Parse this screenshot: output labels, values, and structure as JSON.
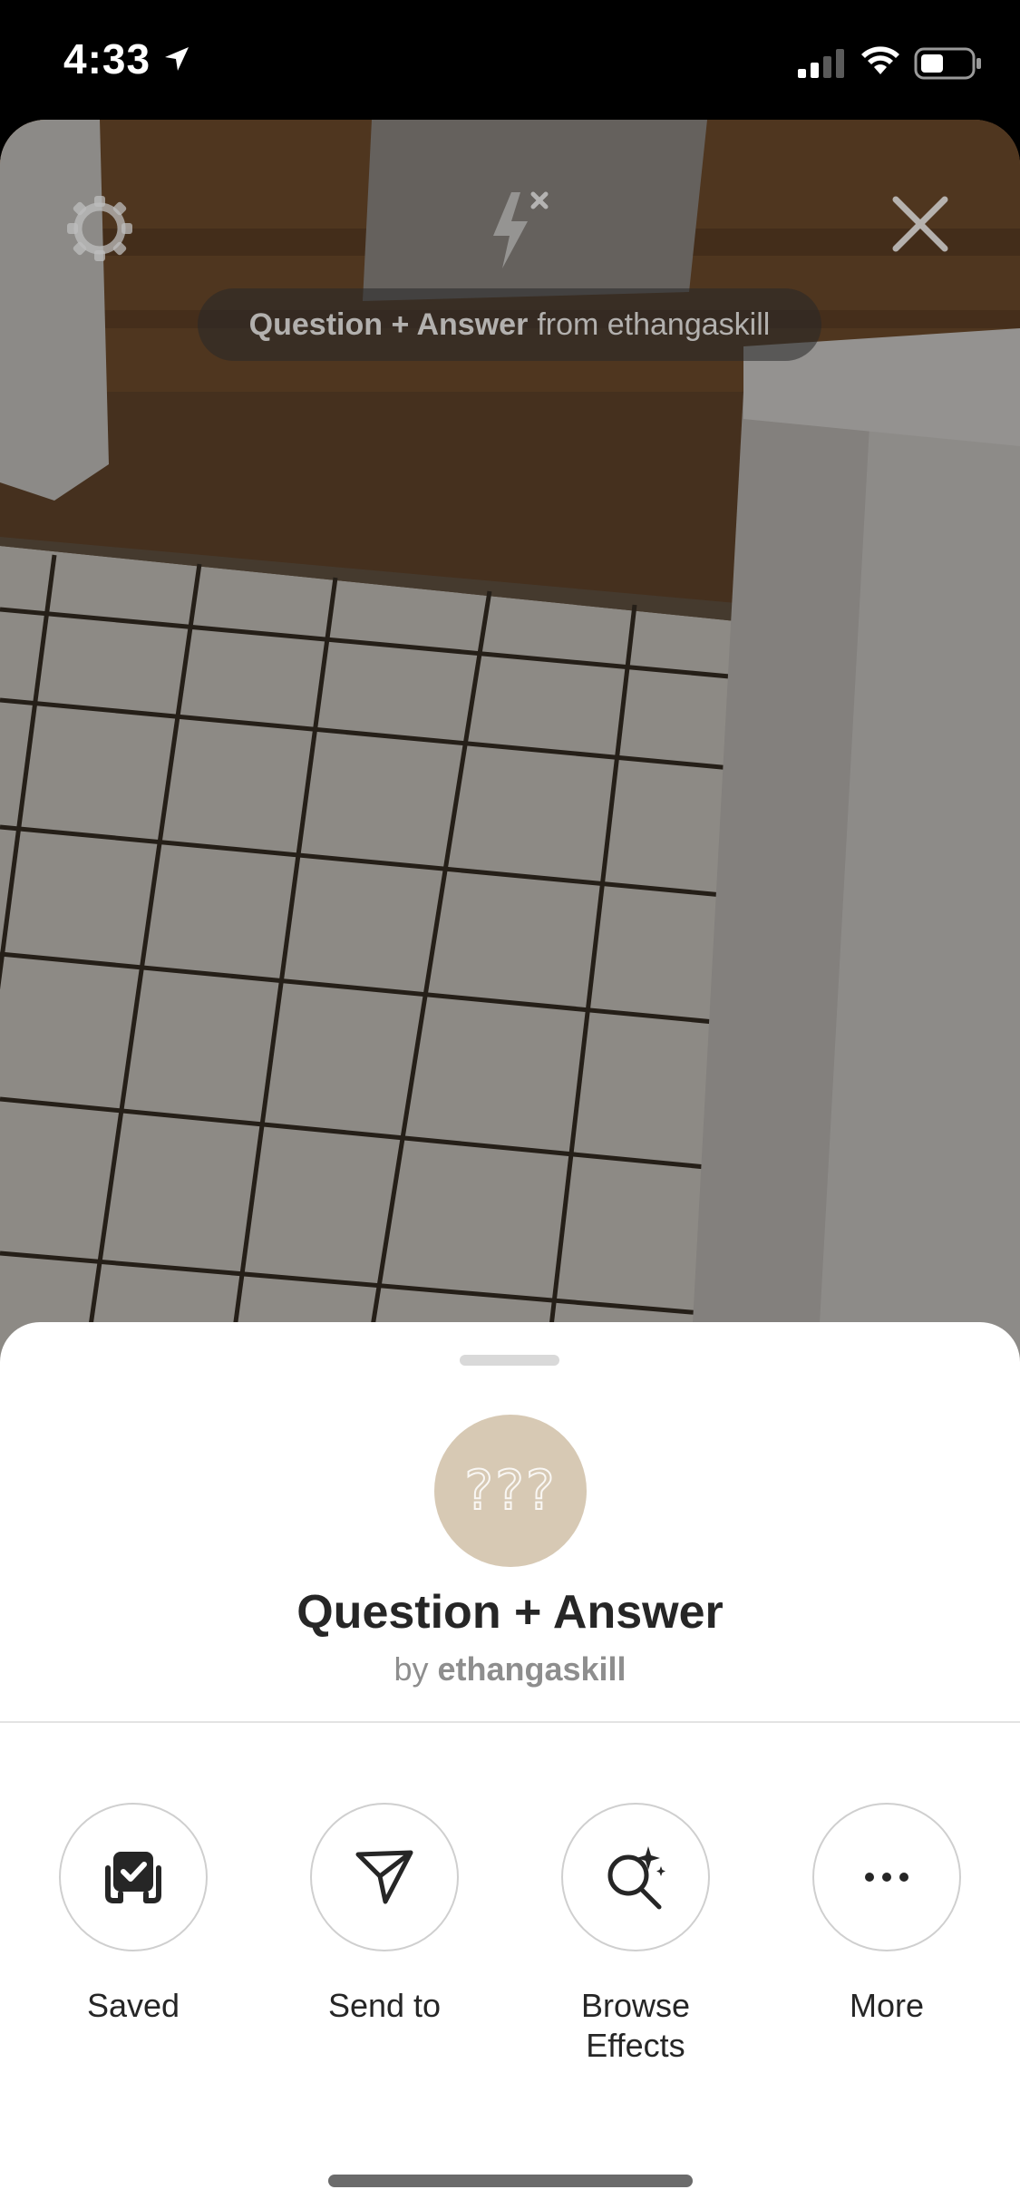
{
  "status_bar": {
    "time": "4:33",
    "icons": [
      "location-arrow-icon",
      "signal-icon",
      "wifi-icon",
      "battery-icon"
    ]
  },
  "camera": {
    "controls": [
      "settings-icon",
      "flash-off-icon",
      "close-icon"
    ],
    "effect_pill": {
      "title": "Question + Answer",
      "from_text": "from ethangaskill"
    }
  },
  "sheet": {
    "thumbnail_text": "???",
    "thumbnail_color": "#d7c9b4",
    "title": "Question + Answer",
    "by_prefix": "by",
    "author": "ethangaskill",
    "actions": [
      {
        "label": "Saved",
        "icon": "saved-check-icon"
      },
      {
        "label": "Send to",
        "icon": "send-icon"
      },
      {
        "label": "Browse\nEffects",
        "icon": "browse-effects-icon"
      },
      {
        "label": "More",
        "icon": "more-icon"
      }
    ]
  }
}
